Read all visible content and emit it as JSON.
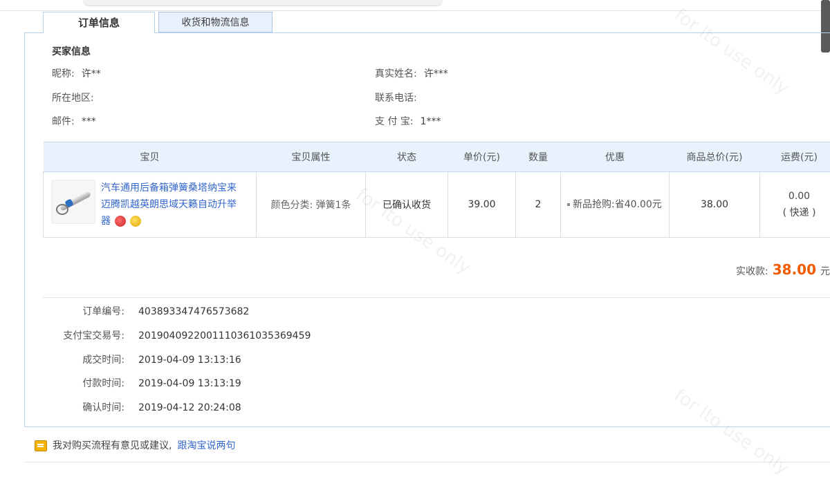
{
  "tabs": {
    "order_info": "订单信息",
    "logistics": "收货和物流信息"
  },
  "buyer": {
    "title": "买家信息",
    "nickname_label": "昵称:",
    "nickname": "许**",
    "realname_label": "真实姓名:",
    "realname": "许***",
    "region_label": "所在地区:",
    "region": "",
    "phone_label": "联系电话:",
    "phone": "",
    "email_label": "邮件:",
    "email": "***",
    "alipay_label": "支 付 宝:",
    "alipay": "1***"
  },
  "table": {
    "headers": [
      "宝贝",
      "宝贝属性",
      "状态",
      "单价(元)",
      "数量",
      "优惠",
      "商品总价(元)",
      "运费(元)"
    ],
    "row": {
      "product": "汽车通用后备箱弹簧桑塔纳宝来迈腾凯越英朗思域天籁自动升举器",
      "attr": "颜色分类: 弹簧1条",
      "status": "已确认收货",
      "price": "39.00",
      "qty": "2",
      "promo": "新品抢购:省40.00元",
      "total": "38.00",
      "shipping": "0.00",
      "shipping_type": "( 快递 )"
    }
  },
  "summary": {
    "label": "实收款:",
    "amount": "38.00",
    "unit": "元"
  },
  "details": [
    {
      "label": "订单编号:",
      "value": "403893347476573682"
    },
    {
      "label": "支付宝交易号:",
      "value": "2019040922001110361035369459"
    },
    {
      "label": "成交时间:",
      "value": "2019-04-09 13:13:16"
    },
    {
      "label": "付款时间:",
      "value": "2019-04-09 13:13:19"
    },
    {
      "label": "确认时间:",
      "value": "2019-04-12 20:24:08"
    }
  ],
  "feedback": {
    "text": "我对购买流程有意见或建议,",
    "link": "跟淘宝说两句"
  },
  "watermark": "for lto use only",
  "colors": {
    "accent": "#f05a00",
    "link": "#3366cc",
    "header_bg": "#e8f2fd"
  }
}
